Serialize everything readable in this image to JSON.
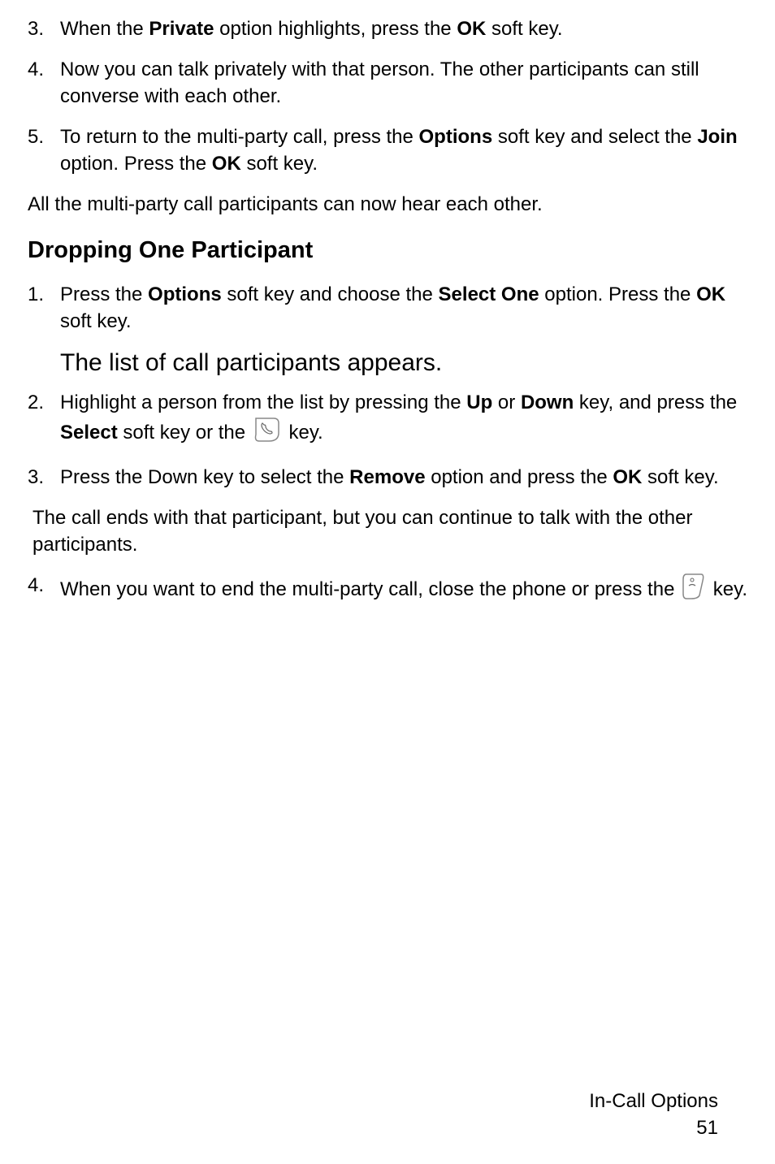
{
  "list1": {
    "items": [
      {
        "num": "3.",
        "prefix": "When the ",
        "bold1": "Private",
        "mid1": " option highlights, press the ",
        "bold2": "OK",
        "suffix": " soft key."
      },
      {
        "num": "4.",
        "text": "Now you can talk privately with that person. The other participants can still converse with each other."
      },
      {
        "num": "5.",
        "prefix": "To return to the multi-party call, press the ",
        "bold1": "Options",
        "mid1": " soft key and select the ",
        "bold2": "Join",
        "mid2": " option. Press the ",
        "bold3": "OK",
        "suffix": " soft key."
      }
    ]
  },
  "para1": "All the multi-party call participants can now hear each other.",
  "heading": "Dropping One Participant",
  "list2": {
    "items": [
      {
        "num": "1.",
        "prefix": "Press the ",
        "bold1": "Options",
        "mid1": " soft key and choose the ",
        "bold2": "Select One",
        "mid2": " option. Press the ",
        "bold3": "OK",
        "suffix": " soft key."
      }
    ]
  },
  "subpara": "The list of call participants appears.",
  "list3": {
    "items": [
      {
        "num": "2.",
        "prefix": "Highlight a person from the list by pressing the ",
        "bold1": "Up",
        "mid1": " or ",
        "bold2": "Down",
        "mid2": " key, and press the ",
        "bold3": "Select",
        "mid3": " soft key or the ",
        "suffix": " key."
      },
      {
        "num": "3.",
        "prefix": "Press the Down key to select the ",
        "bold1": "Remove",
        "mid1": " option and press the ",
        "bold2": "OK",
        "suffix": " soft key."
      }
    ]
  },
  "para2": "The call ends with that participant, but you can continue to talk with the other participants.",
  "list4": {
    "items": [
      {
        "num": "4.",
        "prefix": "When you want to end the multi-party call, close the phone or press the ",
        "suffix": " key."
      }
    ]
  },
  "footer": {
    "title": "In-Call Options",
    "page": "51"
  }
}
